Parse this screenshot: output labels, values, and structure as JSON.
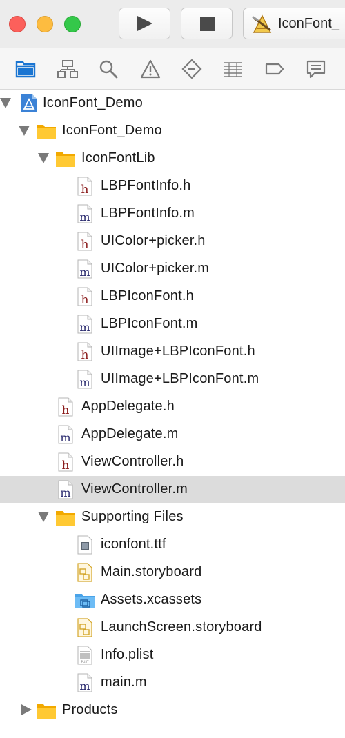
{
  "toolbar": {
    "scheme_label": "IconFont_"
  },
  "navigator_tabs": [
    {
      "icon": "folder-icon"
    },
    {
      "icon": "hierarchy-icon"
    },
    {
      "icon": "search-icon"
    },
    {
      "icon": "warning-icon"
    },
    {
      "icon": "test-diamond-icon"
    },
    {
      "icon": "list-icon"
    },
    {
      "icon": "breakpoint-icon"
    },
    {
      "icon": "report-icon"
    }
  ],
  "colors": {
    "accent": "#1a75d2",
    "header_file": "#8b1c1c",
    "source_file": "#2a2a6e",
    "selected_row": "#dcdcdc"
  },
  "tree": [
    {
      "label": "IconFont_Demo",
      "type": "project",
      "disclosure": "open"
    },
    {
      "label": "IconFont_Demo",
      "type": "folder",
      "disclosure": "open"
    },
    {
      "label": "IconFontLib",
      "type": "folder",
      "disclosure": "open"
    },
    {
      "label": "LBPFontInfo.h",
      "type": "h"
    },
    {
      "label": "LBPFontInfo.m",
      "type": "m"
    },
    {
      "label": "UIColor+picker.h",
      "type": "h"
    },
    {
      "label": "UIColor+picker.m",
      "type": "m"
    },
    {
      "label": "LBPIconFont.h",
      "type": "h"
    },
    {
      "label": "LBPIconFont.m",
      "type": "m"
    },
    {
      "label": "UIImage+LBPIconFont.h",
      "type": "h"
    },
    {
      "label": "UIImage+LBPIconFont.m",
      "type": "m"
    },
    {
      "label": "AppDelegate.h",
      "type": "h"
    },
    {
      "label": "AppDelegate.m",
      "type": "m"
    },
    {
      "label": "ViewController.h",
      "type": "h"
    },
    {
      "label": "ViewController.m",
      "type": "m",
      "selected": true
    },
    {
      "label": "Supporting Files",
      "type": "folder",
      "disclosure": "open"
    },
    {
      "label": "iconfont.ttf",
      "type": "font"
    },
    {
      "label": "Main.storyboard",
      "type": "storyboard"
    },
    {
      "label": "Assets.xcassets",
      "type": "assets"
    },
    {
      "label": "LaunchScreen.storyboard",
      "type": "storyboard"
    },
    {
      "label": "Info.plist",
      "type": "plist",
      "icon_text": "PLIST"
    },
    {
      "label": "main.m",
      "type": "m"
    },
    {
      "label": "Products",
      "type": "folder",
      "disclosure": "closed"
    }
  ]
}
